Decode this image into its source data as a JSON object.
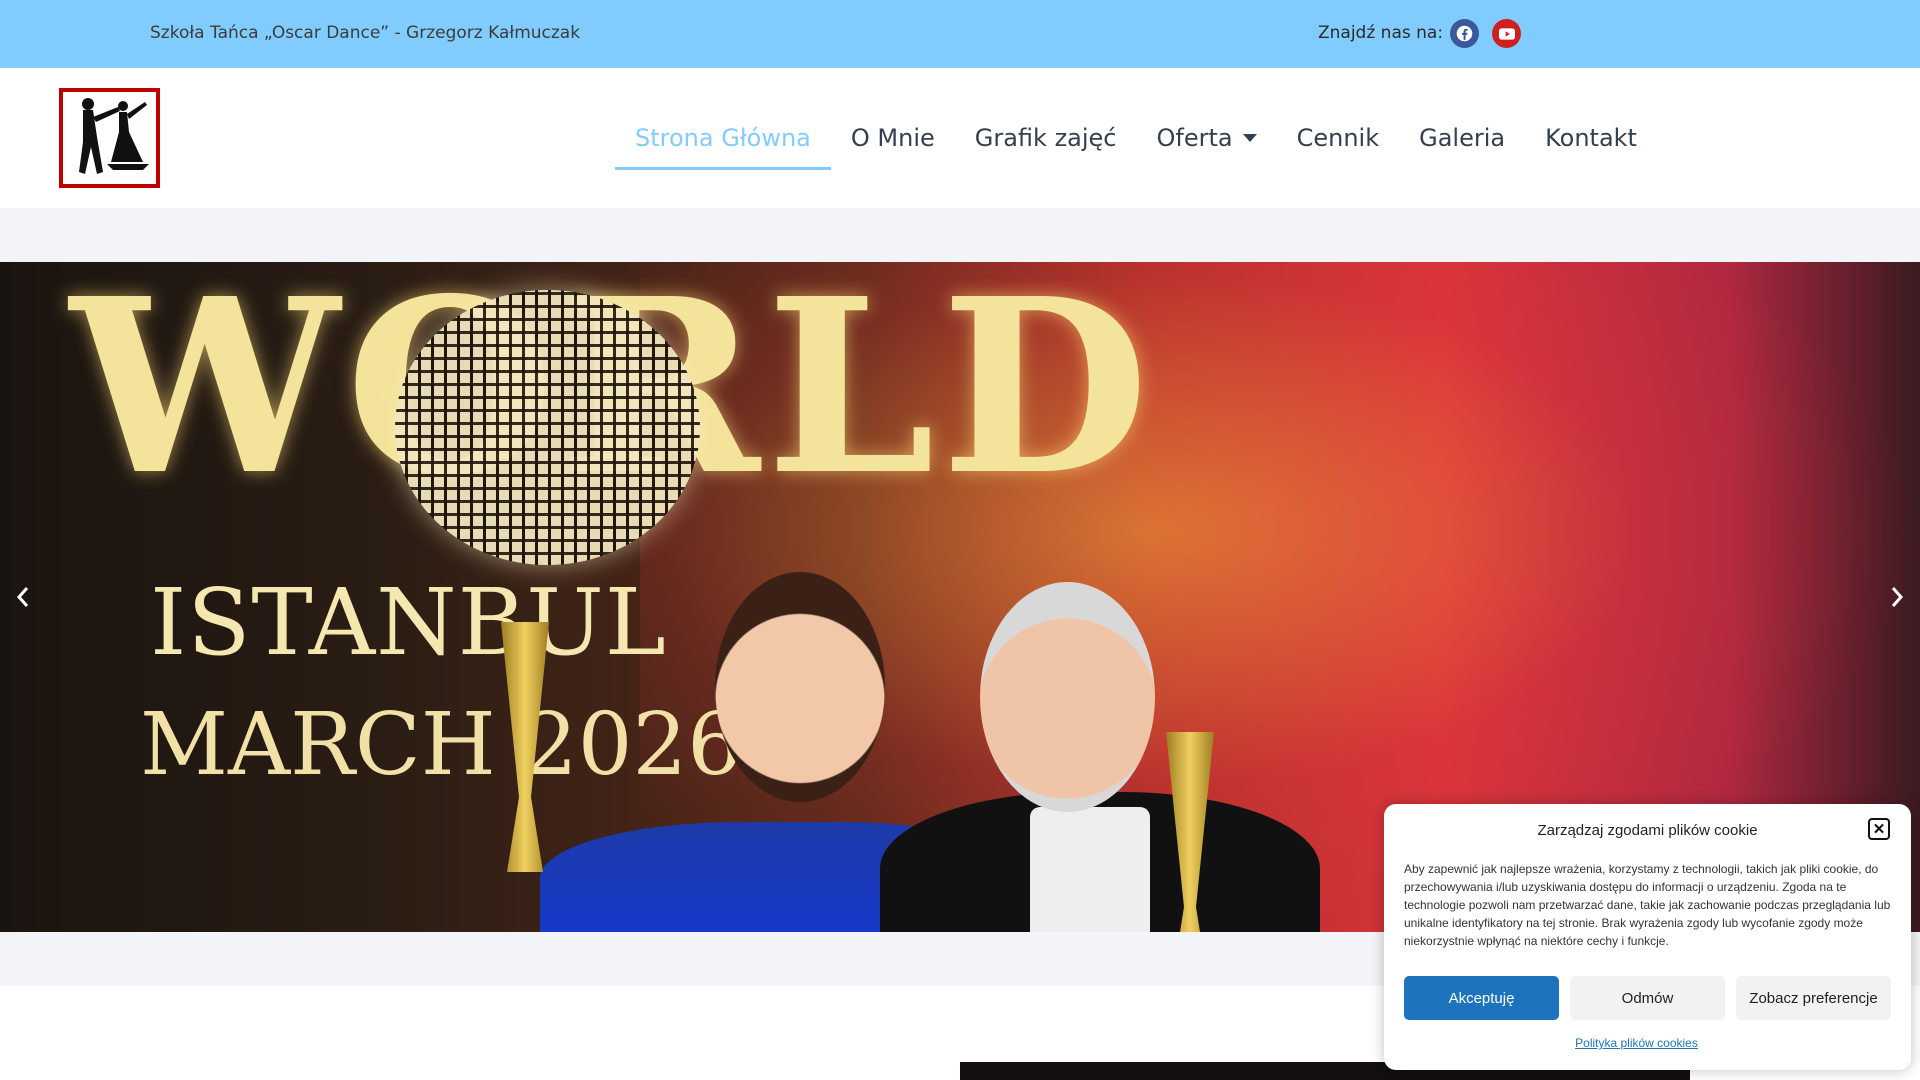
{
  "topbar": {
    "title": "Szkoła Tańca „Oscar Dance” - Grzegorz Kałmuczak",
    "find_us": "Znajdź nas na:",
    "social": [
      "facebook-icon",
      "youtube-icon"
    ]
  },
  "nav": {
    "items": [
      {
        "label": "Strona Główna",
        "active": true
      },
      {
        "label": "O Mnie"
      },
      {
        "label": "Grafik zajęć"
      },
      {
        "label": "Oferta",
        "has_dropdown": true
      },
      {
        "label": "Cennik"
      },
      {
        "label": "Galeria"
      },
      {
        "label": "Kontakt"
      }
    ]
  },
  "slider": {
    "headline": "WORLD",
    "line1": "ISTANBUL",
    "line2": "MARCH 2026"
  },
  "cookie": {
    "title": "Zarządzaj zgodami plików cookie",
    "body": "Aby zapewnić jak najlepsze wrażenia, korzystamy z technologii, takich jak pliki cookie, do przechowywania i/lub uzyskiwania dostępu do informacji o urządzeniu. Zgoda na te technologie pozwoli nam przetwarzać dane, takie jak zachowanie podczas przeglądania lub unikalne identyfikatory na tej stronie. Brak wyrażenia zgody lub wycofanie zgody może niekorzystnie wpłynąć na niektóre cechy i funkcje.",
    "accept": "Akceptuję",
    "deny": "Odmów",
    "preferences": "Zobacz preferencje",
    "policy_link": "Polityka plików cookies"
  },
  "colors": {
    "topbar": "#80ccff",
    "accent": "#80ccff",
    "accept_button": "#1e73be"
  }
}
